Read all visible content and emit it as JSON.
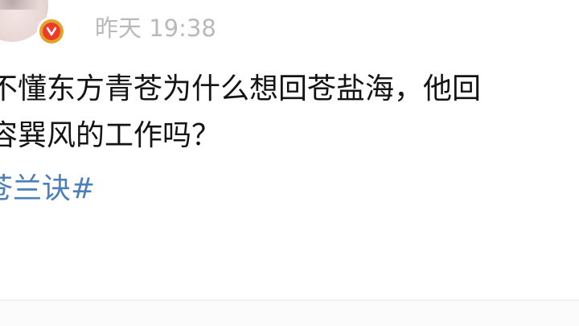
{
  "post": {
    "timestamp": "昨天 19:38",
    "body_lines": [
      "不懂东方青苍为什么想回苍盐海，他回",
      "容巽风的工作吗？"
    ],
    "hashtag": "苍兰诀#",
    "badge_icon": "verified-v-icon",
    "badge_colors": {
      "ring": "#e2a22a",
      "fill": "#ef3a2a"
    },
    "hashtag_color": "#4c7fbb"
  }
}
